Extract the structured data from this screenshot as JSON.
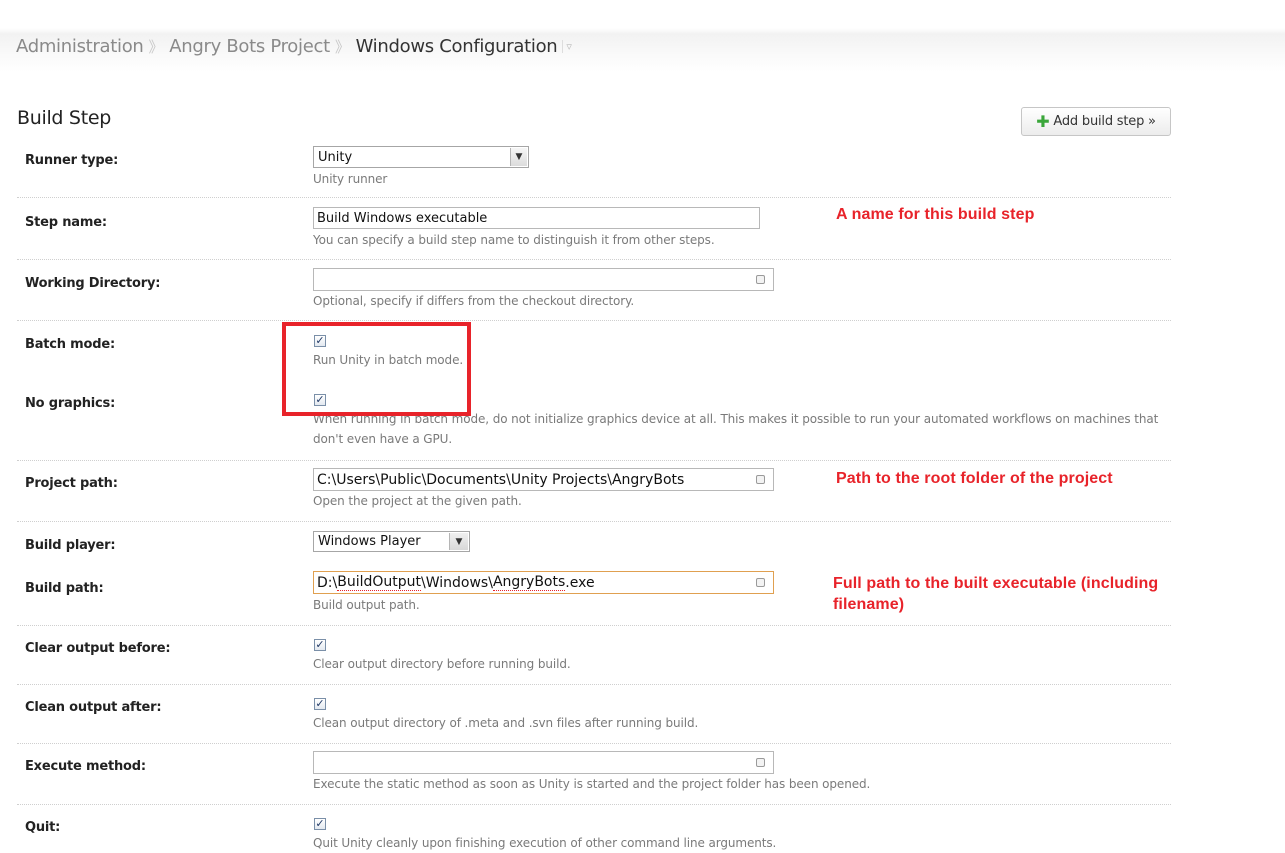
{
  "breadcrumb": {
    "items": [
      "Administration",
      "Angry Bots Project"
    ],
    "current": "Windows Configuration",
    "separator": "》",
    "dropdown_glyph": "▿"
  },
  "section": {
    "title": "Build Step",
    "add_button": "Add build step »"
  },
  "fields": {
    "runner_type": {
      "label": "Runner type:",
      "value": "Unity",
      "hint": "Unity runner"
    },
    "step_name": {
      "label": "Step name:",
      "value": "Build Windows executable",
      "hint": "You can specify a build step name to distinguish it from other steps."
    },
    "working_directory": {
      "label": "Working Directory:",
      "value": "",
      "hint": "Optional, specify if differs from the checkout directory."
    },
    "batch_mode": {
      "label": "Batch mode:",
      "checked": true,
      "hint": "Run Unity in batch mode."
    },
    "no_graphics": {
      "label": "No graphics:",
      "checked": true,
      "hint": "When running in batch mode, do not initialize graphics device at all. This makes it possible to run your automated workflows on machines that don't even have a GPU."
    },
    "project_path": {
      "label": "Project path:",
      "value": "C:\\Users\\Public\\Documents\\Unity Projects\\AngryBots",
      "hint": "Open the project at the given path."
    },
    "build_player": {
      "label": "Build player:",
      "value": "Windows Player"
    },
    "build_path": {
      "label": "Build path:",
      "value_prefix": "D:\\",
      "value_word1": "BuildOutput",
      "value_mid": "\\Windows\\",
      "value_word2": "AngryBots",
      "value_suffix": ".exe",
      "hint": "Build output path."
    },
    "clear_output_before": {
      "label": "Clear output before:",
      "checked": true,
      "hint": "Clear output directory before running build."
    },
    "clean_output_after": {
      "label": "Clean output after:",
      "checked": true,
      "hint": "Clean output directory of .meta and .svn files after running build."
    },
    "execute_method": {
      "label": "Execute method:",
      "value": "",
      "hint": "Execute the static method as soon as Unity is started and the project folder has been opened."
    },
    "quit": {
      "label": "Quit:",
      "checked": true,
      "hint": "Quit Unity cleanly upon finishing execution of other command line arguments."
    }
  },
  "annotations": {
    "step_name": "A name for this build step",
    "project_path": "Path to the root folder of the project",
    "build_path": "Full path to the built executable (including filename)"
  },
  "glyphs": {
    "check": "✓",
    "dropdown_arrow": "▼",
    "plus": "✚"
  },
  "colors": {
    "annotation": "#e8232a",
    "add_icon": "#3aa63a",
    "focus_border": "#e0a050"
  }
}
